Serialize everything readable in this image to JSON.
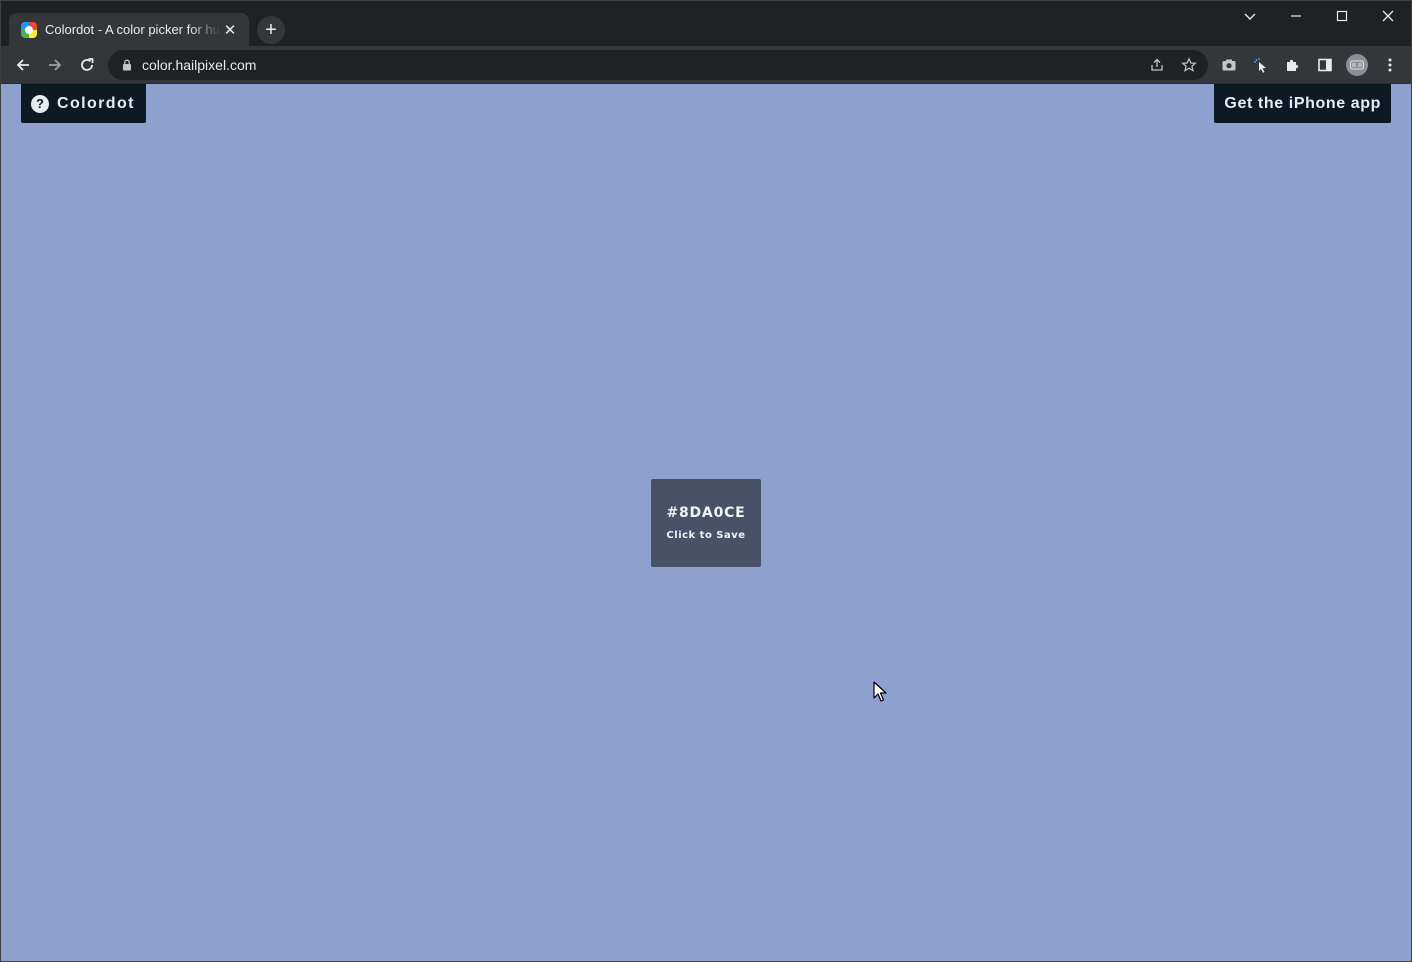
{
  "browser": {
    "tab": {
      "title": "Colordot - A color picker for humans",
      "close_glyph": "✕"
    },
    "new_tab_glyph": "+",
    "window_controls": {
      "tabs_menu_glyph": "⌄",
      "minimize_glyph": "—",
      "maximize_glyph": "☐",
      "close_glyph": "✕"
    },
    "address_bar": {
      "url": "color.hailpixel.com"
    }
  },
  "page": {
    "background_color": "#8DA0CE",
    "brand_button": {
      "icon": "help-icon",
      "icon_glyph": "?",
      "label": "Colordot"
    },
    "app_button": {
      "label": "Get the iPhone app"
    },
    "color_card": {
      "hex": "#8DA0CE",
      "hint": "Click to Save"
    }
  }
}
